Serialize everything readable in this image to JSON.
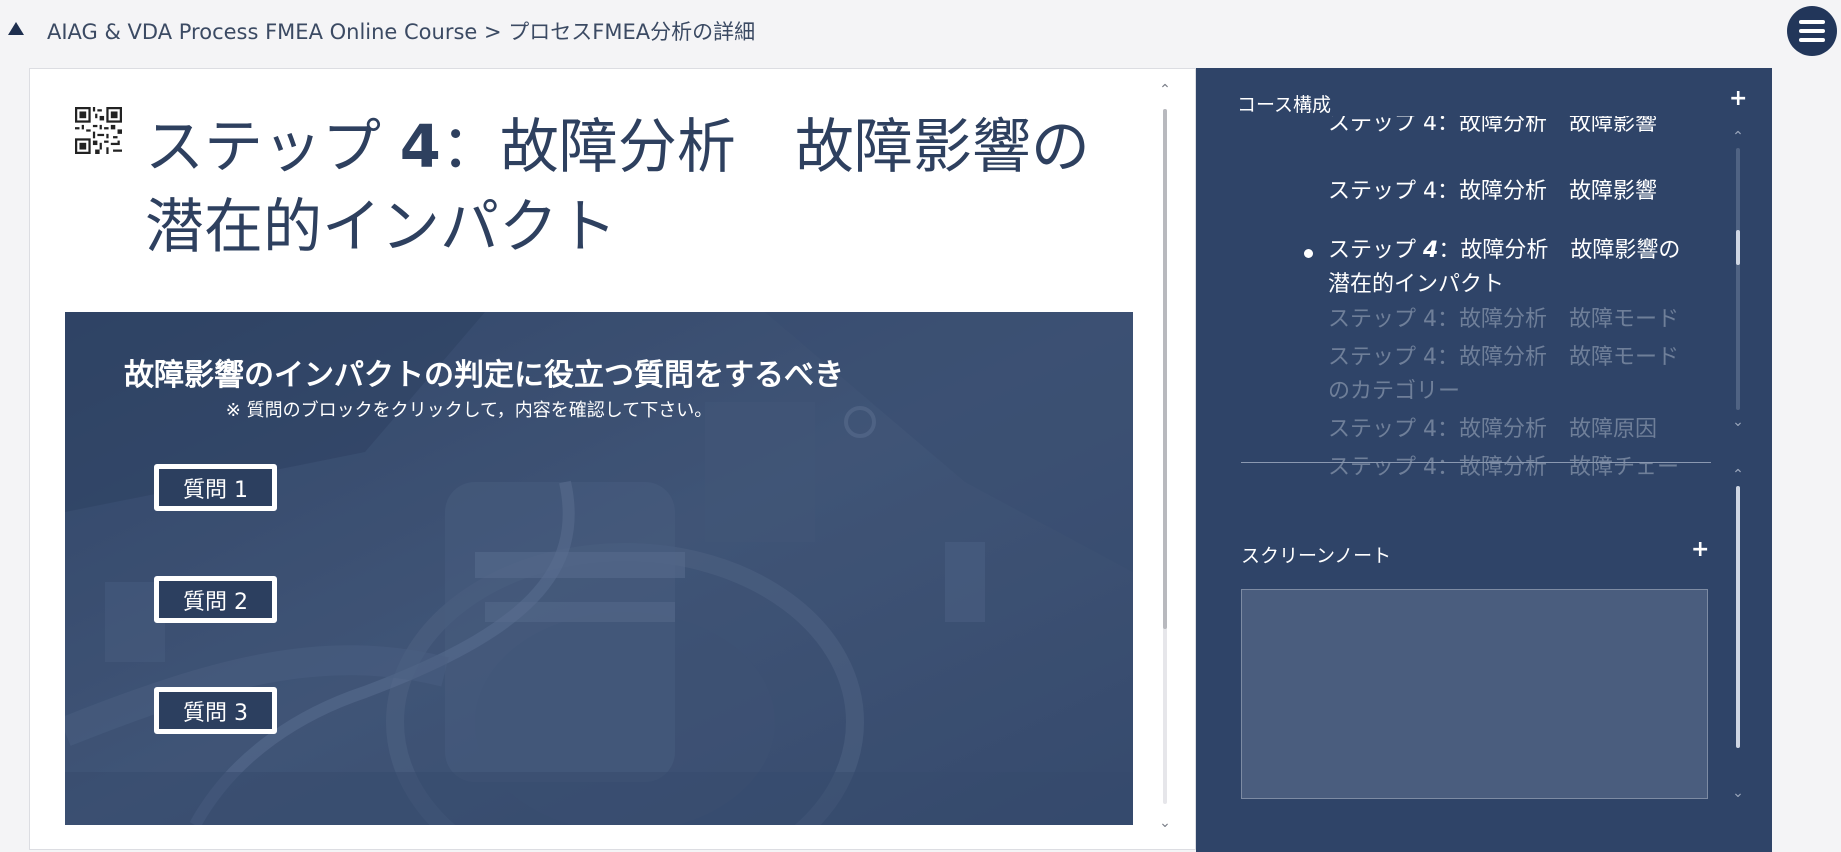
{
  "breadcrumb": {
    "text": "AIAG & VDA Process FMEA Online Course > プロセスFMEA分析の詳細"
  },
  "page": {
    "title_prefix": "ステップ",
    "title_number": "4",
    "title_suffix": "：故障分析　故障影響の潜在的インパクト"
  },
  "slide": {
    "heading": "故障影響のインパクトの判定に役立つ質問をするべき",
    "subheading": "※ 質問のブロックをクリックして，内容を確認して下さい。",
    "questions": [
      "質問 1",
      "質問 2",
      "質問 3"
    ]
  },
  "sidebar": {
    "course_title": "コース構成",
    "outline": [
      {
        "label": "ステップ 4：故障分析　故障影響",
        "state": "done"
      },
      {
        "label": "ステップ 4：故障分析　故障影響",
        "state": "done"
      },
      {
        "label_prefix": "ステップ ",
        "label_number": "4",
        "label_suffix": "：故障分析　故障影響の潜在的インパクト",
        "state": "current"
      },
      {
        "label": "ステップ 4：故障分析　故障モード",
        "state": "locked"
      },
      {
        "label": "ステップ 4：故障分析　故障モードのカテゴリー",
        "state": "locked"
      },
      {
        "label": "ステップ 4：故障分析　故障原因",
        "state": "locked"
      },
      {
        "label": "ステップ 4：故障分析　故障チェー",
        "state": "locked"
      }
    ],
    "notes_title": "スクリーンノート",
    "notes_value": ""
  },
  "colors": {
    "sidebar_bg": "#2f4468",
    "title": "#2e405f",
    "slide_overlay": "#3f5274"
  },
  "icons": {
    "collapse": "triangle-up-icon",
    "menu": "hamburger-menu-icon",
    "qr": "qr-code-icon",
    "expand": "plus-icon"
  }
}
